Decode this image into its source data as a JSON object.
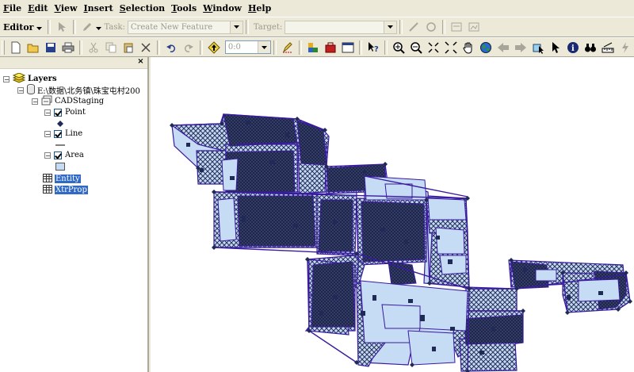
{
  "menu": [
    "File",
    "Edit",
    "View",
    "Insert",
    "Selection",
    "Tools",
    "Window",
    "Help"
  ],
  "editor_toolbar": {
    "editor_label": "Editor",
    "task_label": "Task:",
    "task_value": "Create New Feature",
    "target_label": "Target:",
    "target_value": ""
  },
  "standard_toolbar": {
    "scale_value": "0:0"
  },
  "toc": {
    "root_label": "Layers",
    "dataset_label": "E:\\数据\\北务镇\\珠宝屯村200",
    "group_label": "CADStaging",
    "layers": [
      {
        "label": "Point"
      },
      {
        "label": "Line"
      },
      {
        "label": "Area"
      }
    ],
    "tables": [
      {
        "label": "Entity"
      },
      {
        "label": "XtrProp"
      }
    ]
  },
  "colors": {
    "parcel_fill": "#c6dcf4",
    "parcel_hatch": "#2b3560",
    "parcel_edge": "#3a1aa0",
    "vertex": "#1f2a56",
    "selection_blue": "#316ac5"
  }
}
